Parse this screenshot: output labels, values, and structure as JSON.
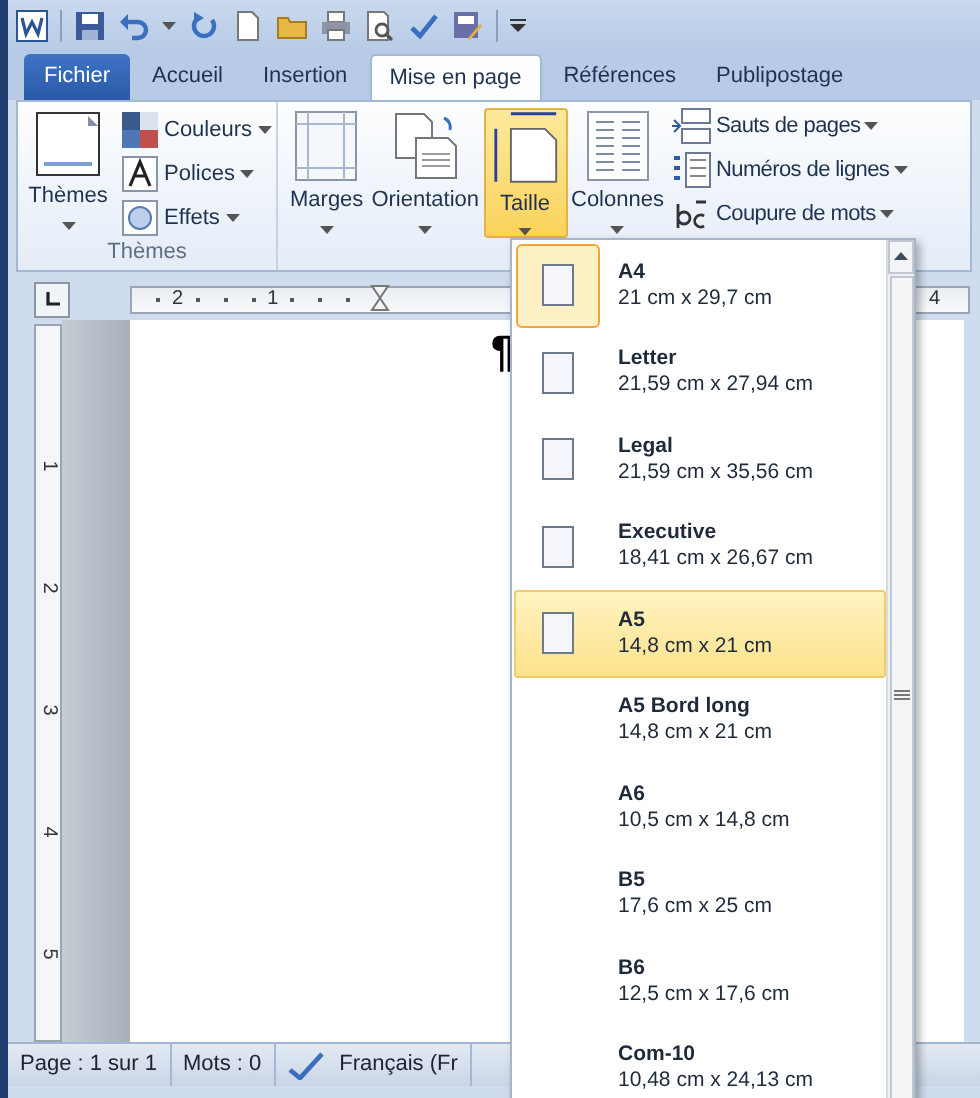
{
  "tabs": [
    {
      "label": "Fichier",
      "kind": "file",
      "selected": false
    },
    {
      "label": "Accueil",
      "kind": "tab",
      "selected": false
    },
    {
      "label": "Insertion",
      "kind": "tab",
      "selected": false
    },
    {
      "label": "Mise en page",
      "kind": "tab",
      "selected": true
    },
    {
      "label": "Références",
      "kind": "tab",
      "selected": false
    },
    {
      "label": "Publipostage",
      "kind": "tab",
      "selected": false
    }
  ],
  "ribbon": {
    "themes_group": {
      "label": "Thèmes",
      "big_button": "Thèmes",
      "items": [
        "Couleurs",
        "Polices",
        "Effets"
      ]
    },
    "page_setup_group": {
      "big_buttons": [
        {
          "label": "Marges",
          "pressed": false
        },
        {
          "label": "Orientation",
          "pressed": false
        },
        {
          "label": "Taille",
          "pressed": true
        },
        {
          "label": "Colonnes",
          "pressed": false
        }
      ],
      "items": [
        "Sauts de pages",
        "Numéros de lignes",
        "Coupure de mots"
      ]
    }
  },
  "ruler": {
    "horizontal_labels": [
      "2",
      "1"
    ],
    "right_label": "4",
    "vertical_labels": [
      "1",
      "2",
      "3",
      "4",
      "5"
    ]
  },
  "document": {
    "paragraph_mark": "¶"
  },
  "status_bar": [
    "Page : 1 sur 1",
    "Mots : 0",
    "Français (Fr"
  ],
  "size_menu": {
    "items": [
      {
        "name": "A4",
        "size": "21 cm x 29,7 cm",
        "selected": true,
        "hovered": false,
        "show_icon": true
      },
      {
        "name": "Letter",
        "size": "21,59 cm x 27,94 cm",
        "selected": false,
        "hovered": false,
        "show_icon": true
      },
      {
        "name": "Legal",
        "size": "21,59 cm x 35,56 cm",
        "selected": false,
        "hovered": false,
        "show_icon": true
      },
      {
        "name": "Executive",
        "size": "18,41 cm x 26,67 cm",
        "selected": false,
        "hovered": false,
        "show_icon": true
      },
      {
        "name": "A5",
        "size": "14,8 cm x 21 cm",
        "selected": false,
        "hovered": true,
        "show_icon": true
      },
      {
        "name": "A5 Bord long",
        "size": "14,8 cm x 21 cm",
        "selected": false,
        "hovered": false,
        "show_icon": false
      },
      {
        "name": "A6",
        "size": "10,5 cm x 14,8 cm",
        "selected": false,
        "hovered": false,
        "show_icon": false
      },
      {
        "name": "B5",
        "size": "17,6 cm x 25 cm",
        "selected": false,
        "hovered": false,
        "show_icon": false
      },
      {
        "name": "B6",
        "size": "12,5 cm x 17,6 cm",
        "selected": false,
        "hovered": false,
        "show_icon": false
      },
      {
        "name": "Com-10",
        "size": "10,48 cm x 24,13 cm",
        "selected": false,
        "hovered": false,
        "show_icon": false
      }
    ]
  }
}
